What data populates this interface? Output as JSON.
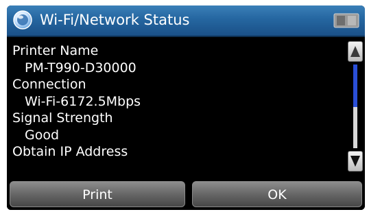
{
  "header": {
    "title": "Wi-Fi/Network Status",
    "icon": "network-status-icon",
    "status_icon": "status-indicator-icon"
  },
  "info": [
    {
      "label": "Printer Name",
      "value": "PM-T990-D30000"
    },
    {
      "label": "Connection",
      "value": "Wi-Fi-6172.5Mbps"
    },
    {
      "label": "Signal Strength",
      "value": "Good"
    },
    {
      "label": "Obtain IP Address"
    }
  ],
  "scroll": {
    "up_icon": "scroll-up-arrow-icon",
    "down_icon": "scroll-down-arrow-icon"
  },
  "buttons": {
    "print_label": "Print",
    "ok_label": "OK"
  },
  "colors": {
    "title_bar": "#2566a0",
    "background": "#000000",
    "scroll_thumb": "#2a4fd8",
    "button": "#6a6a6a",
    "text": "#ffffff"
  }
}
